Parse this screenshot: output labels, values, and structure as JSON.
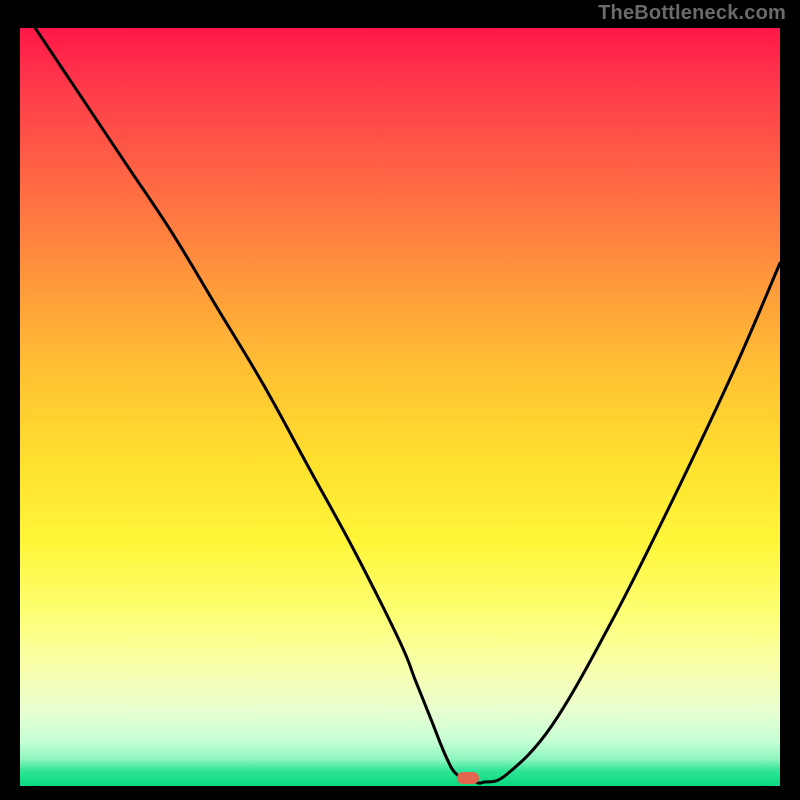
{
  "attribution": "TheBottleneck.com",
  "colors": {
    "frame": "#000000",
    "gradient_top": "#ff1749",
    "gradient_bottom": "#07d97f",
    "curve_stroke": "#000000",
    "marker_fill": "#e2654e",
    "attribution_text": "#6a6a6a"
  },
  "chart_data": {
    "type": "line",
    "title": "",
    "xlabel": "",
    "ylabel": "",
    "xlim": [
      0,
      100
    ],
    "ylim": [
      0,
      100
    ],
    "grid": false,
    "legend": false,
    "note": "Bottleneck-style V-curve. No axis ticks or labels are rendered in the image; x/y values are inferred as percentages of the plot area. y=0 at the bottom (green), y=100 at the top (red).",
    "series": [
      {
        "name": "bottleneck-curve",
        "x": [
          2,
          8,
          14,
          20,
          26,
          32,
          38,
          44,
          50,
          52,
          54,
          56,
          57.5,
          60,
          61,
          64,
          70,
          78,
          86,
          94,
          100
        ],
        "y": [
          100,
          91,
          82,
          73,
          63,
          53,
          42,
          31,
          19,
          14,
          9,
          4,
          1.5,
          0.5,
          0.5,
          1.5,
          8,
          22,
          38,
          55,
          69
        ]
      }
    ],
    "marker": {
      "name": "min-indicator",
      "x": 59,
      "y": 0.5,
      "shape": "rounded-pill",
      "fill": "#e2654e"
    }
  }
}
